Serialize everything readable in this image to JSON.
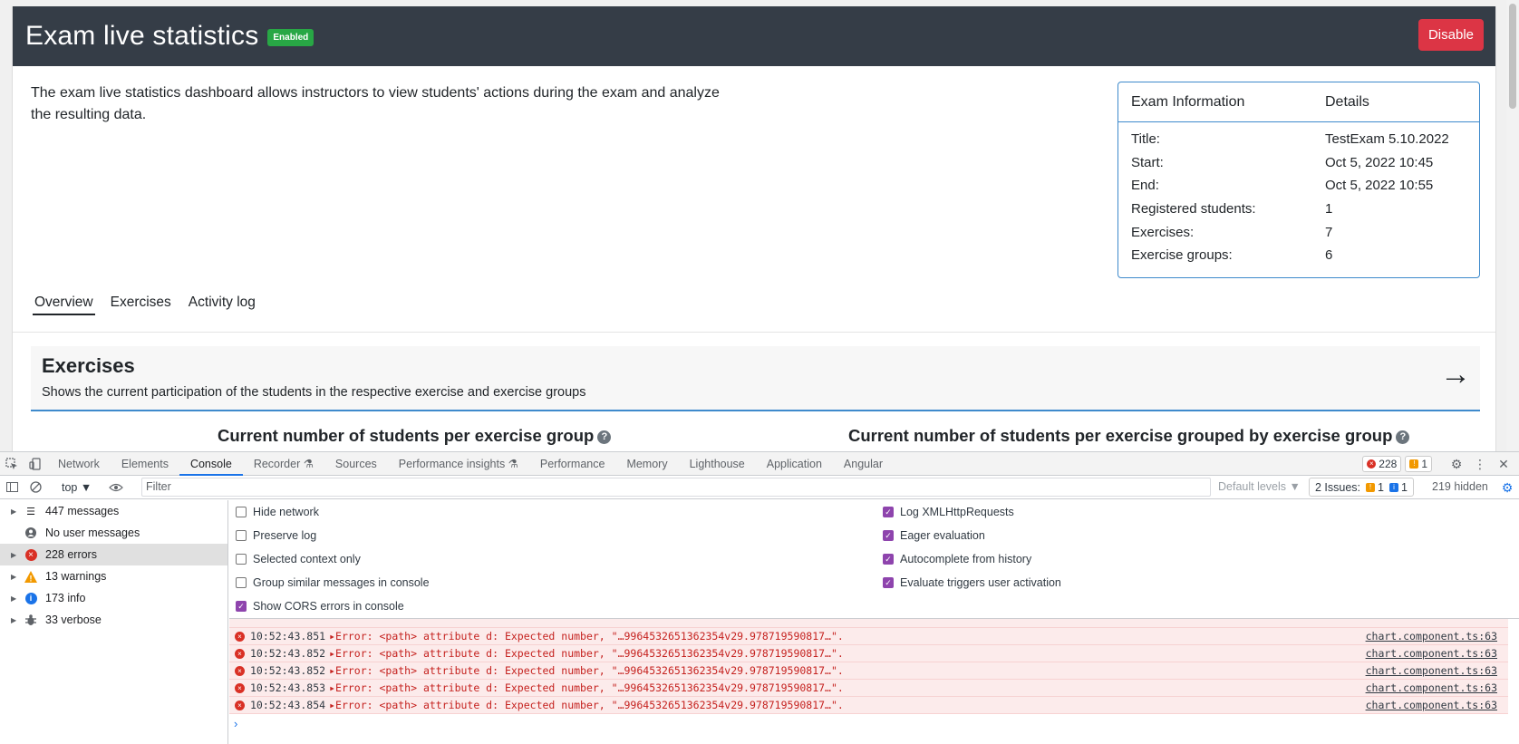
{
  "header": {
    "title": "Exam live statistics",
    "badge": "Enabled",
    "disable_label": "Disable"
  },
  "description": "The exam live statistics dashboard allows instructors to view students' actions during the exam and analyze the resulting data.",
  "exam_info": {
    "col1": "Exam Information",
    "col2": "Details",
    "rows": [
      {
        "label": "Title:",
        "value": "TestExam 5.10.2022"
      },
      {
        "label": "Start:",
        "value": "Oct 5, 2022 10:45"
      },
      {
        "label": "End:",
        "value": "Oct 5, 2022 10:55"
      },
      {
        "label": "Registered students:",
        "value": "1"
      },
      {
        "label": "Exercises:",
        "value": "7"
      },
      {
        "label": "Exercise groups:",
        "value": "6"
      }
    ]
  },
  "tabs": [
    "Overview",
    "Exercises",
    "Activity log"
  ],
  "exercises_card": {
    "title": "Exercises",
    "subtitle": "Shows the current participation of the students in the respective exercise and exercise groups",
    "arrow": "→"
  },
  "chart_titles": [
    "Current number of students per exercise group",
    "Current number of students per exercise grouped by exercise group"
  ],
  "help_glyph": "?",
  "devtools": {
    "tabs": [
      "Network",
      "Elements",
      "Console",
      "Recorder ⚗",
      "Sources",
      "Performance insights ⚗",
      "Performance",
      "Memory",
      "Lighthouse",
      "Application",
      "Angular"
    ],
    "active_tab": "Console",
    "error_count": "228",
    "warning_count": "1",
    "context": "top ▼",
    "filter_placeholder": "Filter",
    "default_levels": "Default levels ▼",
    "issues_label": "2 Issues:",
    "issues_warn": "1",
    "issues_info": "1",
    "hidden": "219 hidden",
    "sidebar": [
      {
        "label": "447 messages",
        "icon": "list-icon"
      },
      {
        "label": "No user messages",
        "icon": "user-icon"
      },
      {
        "label": "228 errors",
        "icon": "error-icon"
      },
      {
        "label": "13 warnings",
        "icon": "warning-icon"
      },
      {
        "label": "173 info",
        "icon": "info-icon"
      },
      {
        "label": "33 verbose",
        "icon": "bug-icon"
      }
    ],
    "settings_left": [
      {
        "label": "Hide network",
        "checked": false
      },
      {
        "label": "Preserve log",
        "checked": false
      },
      {
        "label": "Selected context only",
        "checked": false
      },
      {
        "label": "Group similar messages in console",
        "checked": false
      },
      {
        "label": "Show CORS errors in console",
        "checked": true
      }
    ],
    "settings_right": [
      {
        "label": "Log XMLHttpRequests",
        "checked": true
      },
      {
        "label": "Eager evaluation",
        "checked": true
      },
      {
        "label": "Autocomplete from history",
        "checked": true
      },
      {
        "label": "Evaluate triggers user activation",
        "checked": true
      }
    ],
    "log": [
      {
        "time": "10:52:43.851",
        "msg": "▸Error: <path> attribute d: Expected number, \"…9964532651362354v29.978719590817…\".",
        "src": "chart.component.ts:63"
      },
      {
        "time": "10:52:43.852",
        "msg": "▸Error: <path> attribute d: Expected number, \"…9964532651362354v29.978719590817…\".",
        "src": "chart.component.ts:63"
      },
      {
        "time": "10:52:43.852",
        "msg": "▸Error: <path> attribute d: Expected number, \"…9964532651362354v29.978719590817…\".",
        "src": "chart.component.ts:63"
      },
      {
        "time": "10:52:43.853",
        "msg": "▸Error: <path> attribute d: Expected number, \"…9964532651362354v29.978719590817…\".",
        "src": "chart.component.ts:63"
      },
      {
        "time": "10:52:43.854",
        "msg": "▸Error: <path> attribute d: Expected number, \"…9964532651362354v29.978719590817…\".",
        "src": "chart.component.ts:63"
      }
    ],
    "prompt": "›"
  }
}
